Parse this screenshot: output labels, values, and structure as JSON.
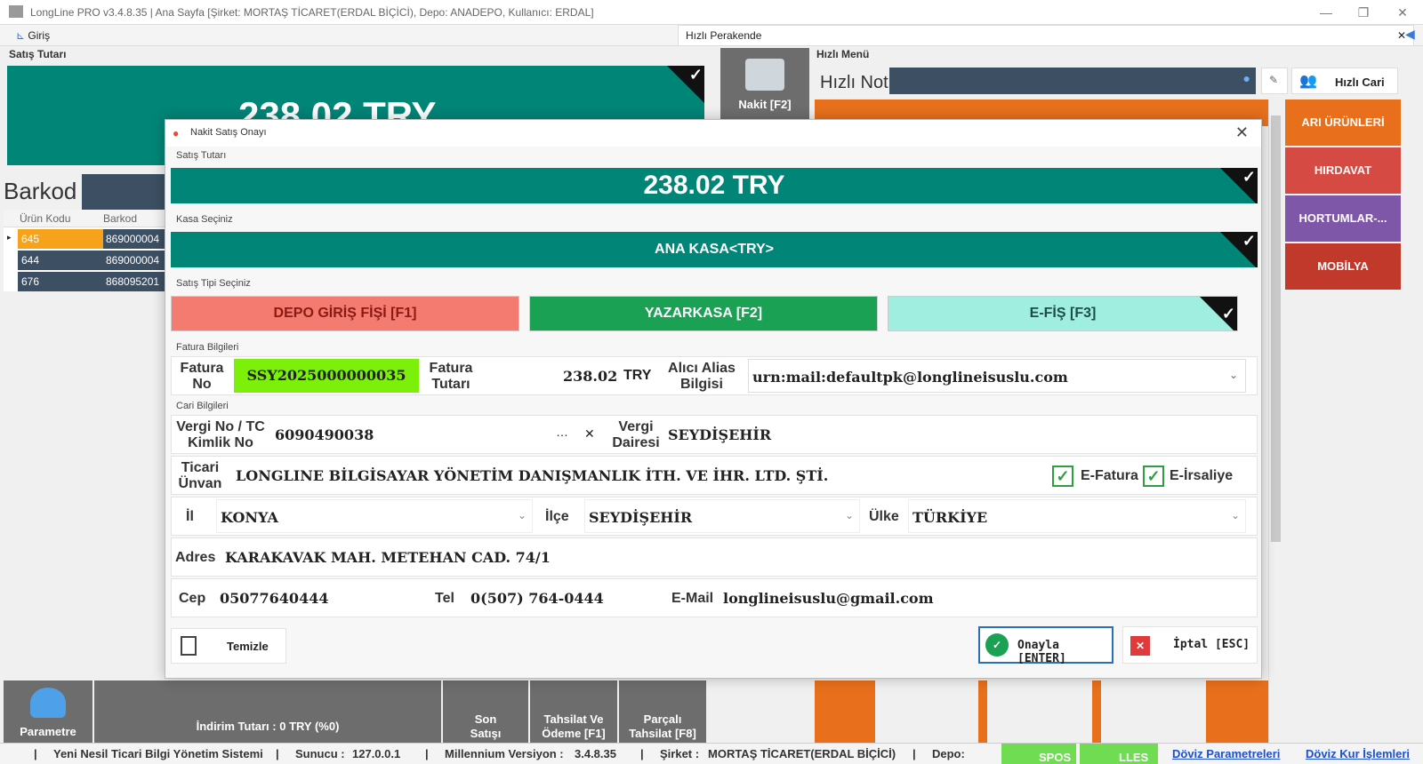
{
  "window": {
    "title": "LongLine PRO v3.4.8.35 | Ana Sayfa [Şirket: MORTAŞ TİCARET(ERDAL BİÇİCİ), Depo: ANADEPO, Kullanıcı: ERDAL]"
  },
  "tabs": {
    "giris": "Giriş",
    "hizli_perakende": "Hızlı Perakende"
  },
  "background": {
    "satis_tutari_label": "Satış Tutarı",
    "satis_tutari_value": "238.02 TRY",
    "barkod_label": "Barkod",
    "columns": [
      "Ürün Kodu",
      "Barkod"
    ],
    "rows": [
      {
        "kod": "645",
        "barkod": "869000004"
      },
      {
        "kod": "644",
        "barkod": "869000004"
      },
      {
        "kod": "676",
        "barkod": "868095201"
      }
    ],
    "hizli_menu": "Hızlı Menü",
    "nakit_button": "Nakit [F2]",
    "hizli_not": "Hızlı Not",
    "hizli_cari": "Hızlı Cari",
    "categories": [
      {
        "label": "ARI ÜRÜNLERİ",
        "color": "#e8701c"
      },
      {
        "label": "HIRDAVAT",
        "color": "#d64a44"
      },
      {
        "label": "HORTUMLAR-...",
        "color": "#7e57a8"
      },
      {
        "label": "MOBİLYA",
        "color": "#c0392b"
      }
    ],
    "parametre": "Parametre",
    "indirim": "İndirim Tutarı : 0 TRY (%0)",
    "son_satisi": "Son Satışı Getir",
    "tahsilat": "Tahsilat Ve Ödeme [F1]",
    "parcali": "Parçalı Tahsilat [F8]"
  },
  "dialog": {
    "title": "Nakit Satış Onayı",
    "satis_tutari_label": "Satış Tutarı",
    "satis_tutari_value": "238.02 TRY",
    "kasa_label": "Kasa Seçiniz",
    "kasa_value": "ANA KASA<TRY>",
    "satis_tipi_label": "Satış Tipi Seçiniz",
    "satis_tipleri": [
      {
        "label": "DEPO GİRİŞ FİŞİ [F1]",
        "color": "#f47b70"
      },
      {
        "label": "YAZARKASA [F2]",
        "color": "#1aa153"
      },
      {
        "label": "E-FİŞ [F3]",
        "color": "#9feee0",
        "selected": true
      }
    ],
    "fatura_bilgileri_label": "Fatura Bilgileri",
    "fatura_no_label": "Fatura No",
    "fatura_no": "SSY2025000000035",
    "fatura_tutari_label": "Fatura Tutarı",
    "fatura_tutari": "238.02",
    "currency": "TRY",
    "alici_alias_label": "Alıcı Alias Bilgisi",
    "alici_alias": "urn:mail:defaultpk@longlineisuslu.com",
    "cari_bilgileri_label": "Cari Bilgileri",
    "vergi_no_label": "Vergi No / TC Kimlik No",
    "vergi_no": "6090490038",
    "vergi_dairesi_label": "Vergi Dairesi",
    "vergi_dairesi": "SEYDİŞEHİR",
    "ticari_unvan_label": "Ticari Ünvan",
    "ticari_unvan": "LONGLINE BİLGİSAYAR YÖNETİM DANIŞMANLIK İTH. VE İHR. LTD. ŞTİ.",
    "efatura_label": "E-Fatura",
    "eirsaliye_label": "E-İrsaliye",
    "il_label": "İl",
    "il": "KONYA",
    "ilce_label": "İlçe",
    "ilce": "SEYDİŞEHİR",
    "ulke_label": "Ülke",
    "ulke": "TÜRKİYE",
    "adres_label": "Adres",
    "adres": "KARAKAVAK MAH. METEHAN CAD. 74/1",
    "cep_label": "Cep",
    "cep": "05077640444",
    "tel_label": "Tel",
    "tel": "0(507) 764-0444",
    "email_label": "E-Mail",
    "email": "longlineisuslu@gmail.com",
    "temizle": "Temizle",
    "onayla": "Onayla [ENTER]",
    "iptal": "İptal [ESC]"
  },
  "statusbar": {
    "system": "Yeni Nesil Ticari Bilgi Yönetim Sistemi",
    "sunucu_label": "Sunucu :",
    "sunucu": "127.0.0.1",
    "version_label": "Millennium Versiyon :",
    "version": "3.4.8.35",
    "sirket_label": "Şirket :",
    "sirket": "MORTAŞ TİCARET(ERDAL BİÇİCİ)",
    "depo_label": "Depo:",
    "spos": "SPOS",
    "lles": "LLES",
    "doviz_param": "Döviz Parametreleri",
    "doviz_kur": "Döviz Kur İşlemleri"
  }
}
